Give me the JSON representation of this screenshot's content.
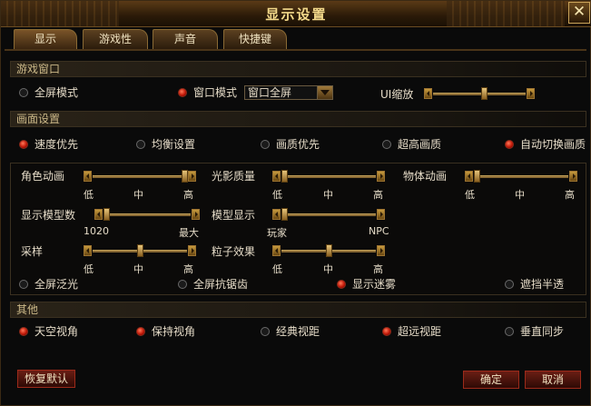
{
  "window": {
    "title": "显示设置",
    "close_label": "✕"
  },
  "tabs": [
    {
      "label": "显示",
      "active": true
    },
    {
      "label": "游戏性",
      "active": false
    },
    {
      "label": "声音",
      "active": false
    },
    {
      "label": "快捷键",
      "active": false
    }
  ],
  "game_window": {
    "section_title": "游戏窗口",
    "fullscreen_label": "全屏模式",
    "fullscreen_selected": false,
    "windowed_label": "窗口模式",
    "windowed_selected": true,
    "window_mode_value": "窗口全屏",
    "ui_scale_label": "UI缩放",
    "ui_scale_level": 0.55
  },
  "quality": {
    "section_title": "画面设置",
    "presets": [
      {
        "label": "速度优先",
        "selected": true
      },
      {
        "label": "均衡设置",
        "selected": false
      },
      {
        "label": "画质优先",
        "selected": false
      },
      {
        "label": "超高画质",
        "selected": false
      },
      {
        "label": "自动切换画质",
        "selected": true
      }
    ],
    "sliders": {
      "role_anim": {
        "label": "角色动画",
        "min": "低",
        "mid": "中",
        "max": "高",
        "level": 1.0
      },
      "lighting": {
        "label": "光影质量",
        "min": "低",
        "mid": "中",
        "max": "高",
        "level": 0.0
      },
      "object_anim": {
        "label": "物体动画",
        "min": "低",
        "mid": "中",
        "max": "高",
        "level": 0.0
      },
      "model_count": {
        "label": "显示模型数",
        "min": "1020",
        "max": "最大",
        "level": 0.0
      },
      "model_display": {
        "label": "模型显示",
        "min": "玩家",
        "max": "NPC",
        "level": 0.0
      },
      "sampling": {
        "label": "采样",
        "min": "低",
        "mid": "中",
        "max": "高",
        "level": 0.5
      },
      "particles": {
        "label": "粒子效果",
        "min": "低",
        "mid": "中",
        "max": "高",
        "level": 0.5
      }
    },
    "options": [
      {
        "label": "全屏泛光",
        "selected": false
      },
      {
        "label": "全屏抗锯齿",
        "selected": false
      },
      {
        "label": "显示迷雾",
        "selected": true
      },
      {
        "label": "遮挡半透",
        "selected": false
      }
    ]
  },
  "other": {
    "section_title": "其他",
    "options": [
      {
        "label": "天空视角",
        "selected": true
      },
      {
        "label": "保持视角",
        "selected": true
      },
      {
        "label": "经典视距",
        "selected": false
      },
      {
        "label": "超远视距",
        "selected": true
      },
      {
        "label": "垂直同步",
        "selected": false
      }
    ]
  },
  "buttons": {
    "restore_label": "恢复默认",
    "ok_label": "确定",
    "cancel_label": "取消"
  }
}
